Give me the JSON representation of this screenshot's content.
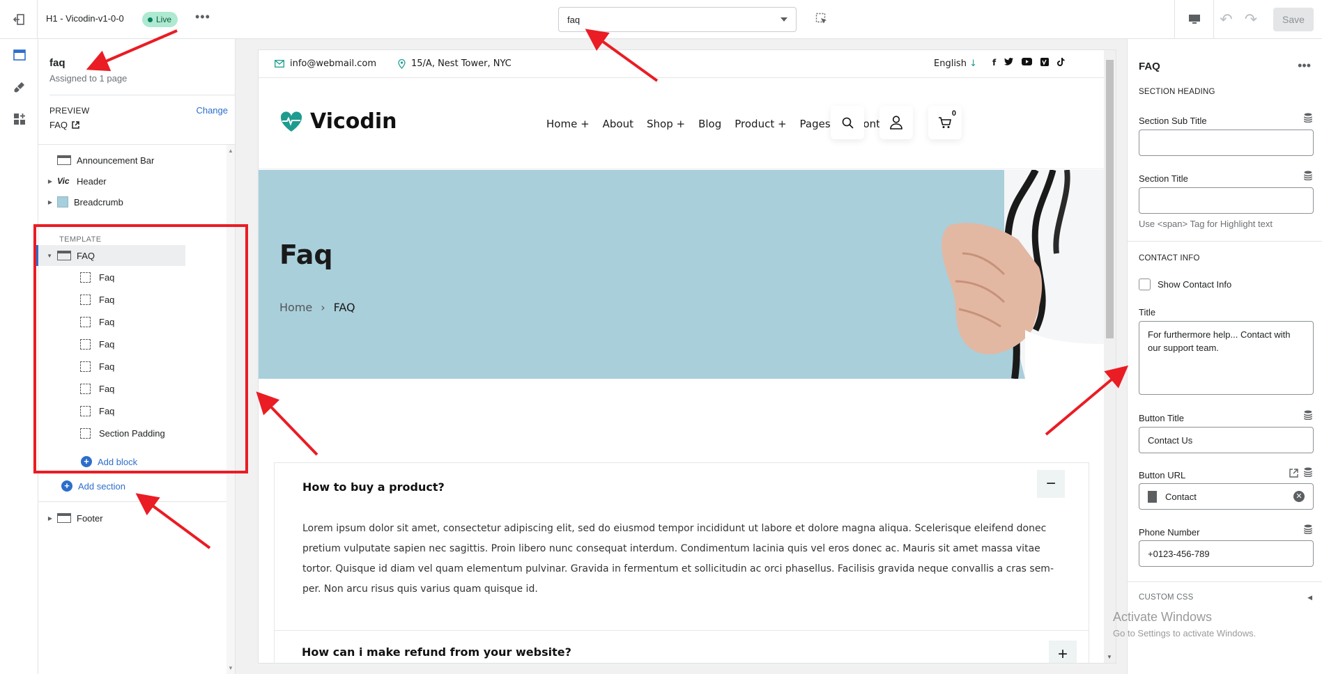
{
  "topbar": {
    "theme_name": "H1 - Vicodin-v1-0-0",
    "live_badge": "Live",
    "page_select_value": "faq",
    "save_label": "Save"
  },
  "sidebar": {
    "page_title": "faq",
    "assigned": "Assigned to 1 page",
    "preview_label": "PREVIEW",
    "change_label": "Change",
    "preview_value": "FAQ",
    "sections": [
      {
        "label": "Announcement Bar",
        "icon": "section-bar-icon"
      },
      {
        "label": "Header",
        "icon": "logo-icon"
      },
      {
        "label": "Breadcrumb",
        "icon": "image-icon"
      }
    ],
    "template_label": "TEMPLATE",
    "template_section": "FAQ",
    "blocks": [
      "Faq",
      "Faq",
      "Faq",
      "Faq",
      "Faq",
      "Faq",
      "Faq",
      "Section Padding"
    ],
    "add_block": "Add block",
    "add_section": "Add section",
    "footer": "Footer"
  },
  "preview": {
    "email": "info@webmail.com",
    "address": "15/A, Nest Tower, NYC",
    "language": "English",
    "logo": "Vicodin",
    "nav": [
      "Home +",
      "About",
      "Shop +",
      "Blog",
      "Product +",
      "Pages +",
      "Contact"
    ],
    "cart_count": "0",
    "hero_title": "Faq",
    "breadcrumb_home": "Home",
    "breadcrumb_sep": "›",
    "breadcrumb_current": "FAQ",
    "faq_q1": "How to buy a product?",
    "faq_a1": "Lorem ipsum dolor sit amet, consectetur adipiscing elit, sed do eiusmod tempor incididunt ut labore et dolore magna aliqua. Scelerisque eleifend donec pretium vulputate sapien nec sagittis. Proin libero nunc consequat interdum. Condimentum lacinia quis vel eros donec ac. Mauris sit amet massa vitae tortor. Quisque id diam vel quam elementum pulvinar. Gravida in fermentum et sollicitudin ac orci phasellus. Facilisis gravida neque convallis a cras sem-per. Non arcu risus quis varius quam quisque id.",
    "faq_btn1": "−",
    "faq_q2": "How can i make refund from your website?",
    "faq_btn2": "+"
  },
  "panel": {
    "title": "FAQ",
    "section_heading": "SECTION HEADING",
    "sub_title_label": "Section Sub Title",
    "sub_title_value": "",
    "title_label": "Section Title",
    "title_value": "",
    "title_help": "Use <span> Tag for Highlight text",
    "contact_info": "CONTACT INFO",
    "show_contact": "Show Contact Info",
    "contact_title_label": "Title",
    "contact_title_value": "For furthermore help... Contact with our support team.",
    "button_title_label": "Button Title",
    "button_title_value": "Contact Us",
    "button_url_label": "Button URL",
    "button_url_value": "Contact",
    "phone_label": "Phone Number",
    "phone_value": "+0123-456-789",
    "custom_css": "CUSTOM CSS"
  },
  "watermark": {
    "line1": "Activate Windows",
    "line2": "Go to Settings to activate Windows."
  },
  "colors": {
    "accent": "#2c6ecb",
    "annotation_red": "#ea1c24",
    "hero_bg": "#a9cfdb",
    "brand_teal": "#1d9c8f"
  }
}
